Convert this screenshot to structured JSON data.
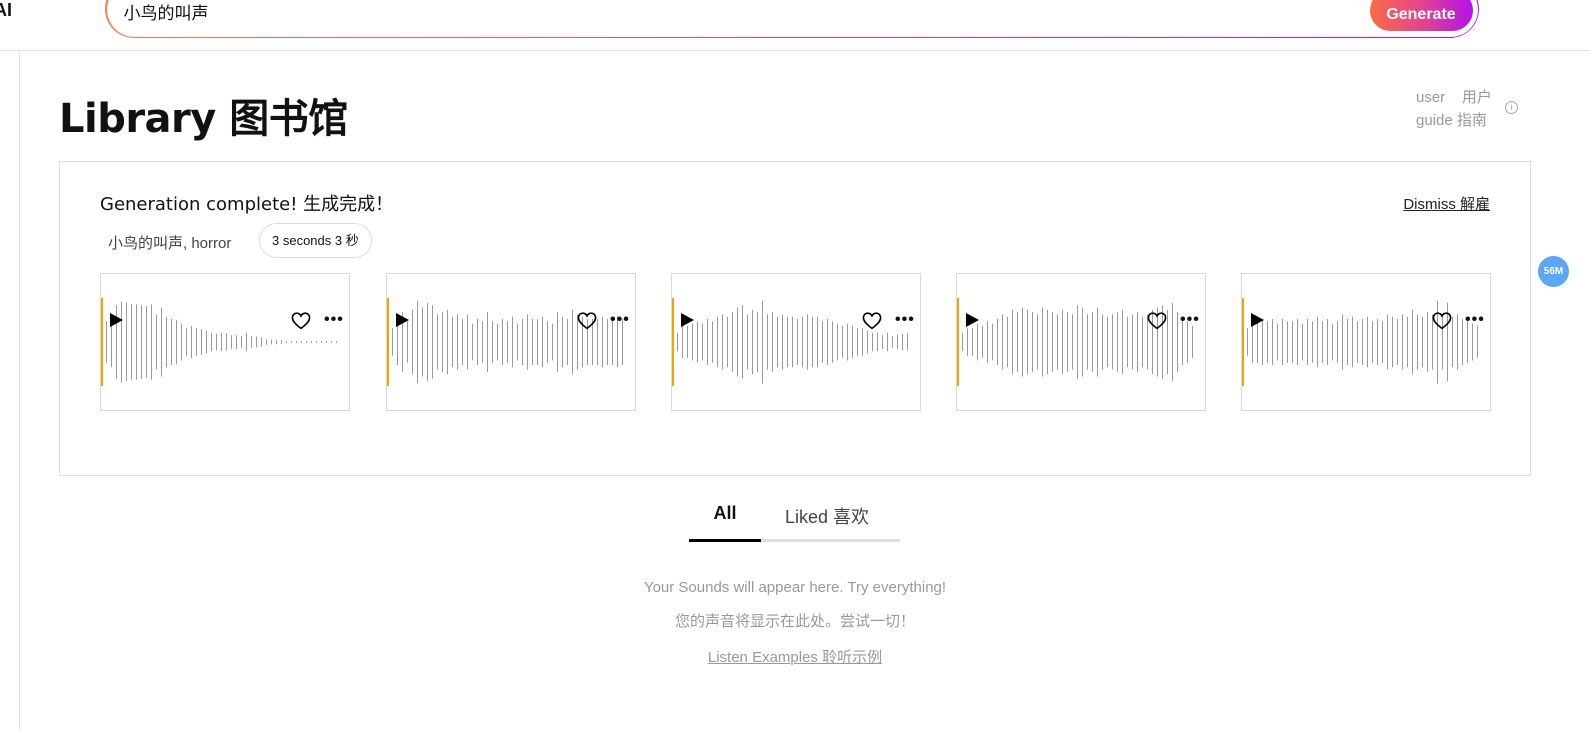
{
  "header": {
    "logo": "AI",
    "search_value": "小鸟的叫声",
    "generate_label": "Generate"
  },
  "page": {
    "title": "Library 图书馆",
    "guide_line1": "user    用户",
    "guide_line2": "guide 指南"
  },
  "panel": {
    "title": "Generation complete! 生成完成！",
    "dismiss": "Dismiss 解雇",
    "prompt": "小鸟的叫声, horror",
    "duration": "3 seconds 3 秒"
  },
  "colors": {
    "playhead": "#f5a300",
    "wave": "#999999",
    "badge": "#5aa7f7"
  },
  "cards": [
    {
      "icons": [
        "play-icon",
        "heart-icon",
        "more-icon"
      ],
      "amplitudes": [
        0.45,
        0.55,
        0.8,
        0.88,
        0.85,
        0.82,
        0.82,
        0.8,
        0.78,
        0.82,
        0.6,
        0.75,
        0.55,
        0.5,
        0.48,
        0.4,
        0.3,
        0.35,
        0.3,
        0.28,
        0.25,
        0.2,
        0.18,
        0.2,
        0.18,
        0.15,
        0.15,
        0.13,
        0.2,
        0.12,
        0.12,
        0.1,
        0.06,
        0.05,
        0.05,
        0.04,
        0.02,
        0.02,
        0.02,
        0.02,
        0.02,
        0.02,
        0.02,
        0.02,
        0.02,
        0.02,
        0.02
      ]
    },
    {
      "icons": [
        "play-icon",
        "heart-icon",
        "more-icon"
      ],
      "amplitudes": [
        0.3,
        0.5,
        0.65,
        0.45,
        0.7,
        0.9,
        0.75,
        0.85,
        0.8,
        0.6,
        0.65,
        0.7,
        0.55,
        0.6,
        0.5,
        0.6,
        0.4,
        0.5,
        0.45,
        0.65,
        0.45,
        0.4,
        0.5,
        0.45,
        0.55,
        0.4,
        0.5,
        0.6,
        0.5,
        0.5,
        0.55,
        0.45,
        0.4,
        0.65,
        0.55,
        0.5,
        0.7,
        0.6,
        0.55,
        0.5,
        0.5,
        0.5,
        0.55,
        0.5,
        0.5,
        0.55,
        0.5
      ]
    },
    {
      "icons": [
        "play-icon",
        "heart-icon",
        "more-icon"
      ],
      "amplitudes": [
        0.2,
        0.35,
        0.35,
        0.4,
        0.45,
        0.4,
        0.5,
        0.45,
        0.55,
        0.6,
        0.55,
        0.65,
        0.75,
        0.8,
        0.6,
        0.7,
        0.65,
        0.9,
        0.6,
        0.65,
        0.55,
        0.6,
        0.55,
        0.55,
        0.5,
        0.55,
        0.6,
        0.55,
        0.55,
        0.45,
        0.5,
        0.45,
        0.4,
        0.35,
        0.4,
        0.35,
        0.3,
        0.3,
        0.25,
        0.2,
        0.2,
        0.15,
        0.2,
        0.12,
        0.15,
        0.18,
        0.18
      ]
    },
    {
      "icons": [
        "play-icon",
        "heart-icon",
        "more-icon"
      ],
      "amplitudes": [
        0.2,
        0.3,
        0.3,
        0.4,
        0.35,
        0.45,
        0.4,
        0.5,
        0.6,
        0.55,
        0.7,
        0.65,
        0.75,
        0.7,
        0.65,
        0.6,
        0.75,
        0.7,
        0.65,
        0.6,
        0.7,
        0.65,
        0.6,
        0.8,
        0.75,
        0.6,
        0.65,
        0.75,
        0.6,
        0.55,
        0.6,
        0.65,
        0.7,
        0.55,
        0.6,
        0.65,
        0.55,
        0.6,
        0.7,
        0.75,
        0.8,
        0.7,
        0.85,
        0.65,
        0.5,
        0.45,
        0.35
      ]
    },
    {
      "icons": [
        "play-icon",
        "heart-icon",
        "more-icon"
      ],
      "amplitudes": [
        0.3,
        0.45,
        0.45,
        0.5,
        0.45,
        0.5,
        0.4,
        0.5,
        0.45,
        0.45,
        0.5,
        0.4,
        0.5,
        0.45,
        0.55,
        0.45,
        0.5,
        0.4,
        0.45,
        0.6,
        0.5,
        0.55,
        0.45,
        0.5,
        0.55,
        0.45,
        0.5,
        0.45,
        0.6,
        0.55,
        0.5,
        0.6,
        0.55,
        0.7,
        0.6,
        0.55,
        0.65,
        0.6,
        0.9,
        0.6,
        0.85,
        0.55,
        0.6,
        0.5,
        0.45,
        0.4,
        0.35
      ]
    }
  ],
  "tabs": [
    {
      "label": "All",
      "active": true
    },
    {
      "label": "Liked 喜欢",
      "active": false
    }
  ],
  "empty": {
    "line1": "Your Sounds will appear here. Try everything!",
    "line2": "您的声音将显示在此处。尝试一切！",
    "link": "Listen Examples 聆听示例"
  },
  "badge": "56M"
}
